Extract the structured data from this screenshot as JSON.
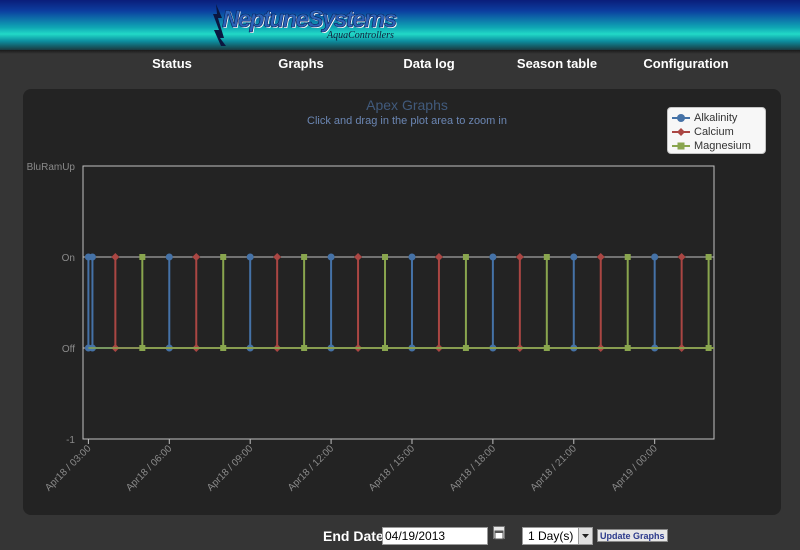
{
  "header": {
    "logo_text": "NeptuneSystems",
    "logo_subtext": "AquaControllers"
  },
  "nav": {
    "items": [
      {
        "label": "Status"
      },
      {
        "label": "Graphs"
      },
      {
        "label": "Data log"
      },
      {
        "label": "Season table"
      },
      {
        "label": "Configuration"
      }
    ]
  },
  "colors": {
    "alkalinity": "#4572a7",
    "calcium": "#aa4643",
    "magnesium": "#89a54e",
    "title": "#415a7c",
    "subtitle": "#6b86b3"
  },
  "chart_data": {
    "type": "line",
    "title": "Apex Graphs",
    "subtitle": "Click and drag in the plot area to zoom in",
    "step": true,
    "x_tick_labels": [
      "Apr18 / 03:00",
      "Apr18 / 06:00",
      "Apr18 / 09:00",
      "Apr18 / 12:00",
      "Apr18 / 15:00",
      "Apr18 / 18:00",
      "Apr18 / 21:00",
      "Apr19 / 00:00"
    ],
    "x_tick_hours": [
      3,
      6,
      9,
      12,
      15,
      18,
      21,
      24
    ],
    "xlim_hours": [
      2.8,
      26.2
    ],
    "y_tick_labels": [
      "BluRamUp",
      "On",
      "Off",
      "-1"
    ],
    "y_tick_values": [
      2,
      1,
      0,
      -1
    ],
    "ylim": [
      -1,
      2
    ],
    "grid": true,
    "legend_position": "top-right",
    "series": [
      {
        "name": "Alkalinity",
        "marker": "circle",
        "x_hours": [
          3.0,
          3.15,
          6.0,
          9.0,
          12.0,
          15.0,
          18.0,
          21.0,
          24.0
        ],
        "y": [
          0,
          1,
          1,
          1,
          1,
          1,
          1,
          1,
          1
        ]
      },
      {
        "name": "Calcium",
        "marker": "diamond",
        "x_hours": [
          4.0,
          7.0,
          10.0,
          13.0,
          16.0,
          19.0,
          22.0,
          25.0
        ],
        "y": [
          1,
          1,
          1,
          1,
          1,
          1,
          1,
          1
        ]
      },
      {
        "name": "Magnesium",
        "marker": "square",
        "x_hours": [
          5.0,
          8.0,
          11.0,
          14.0,
          17.0,
          20.0,
          23.0,
          26.0
        ],
        "y": [
          1,
          1,
          1,
          1,
          1,
          1,
          1,
          1
        ]
      }
    ]
  },
  "controls": {
    "end_date_label": "End Date",
    "end_date_value": "04/19/2013",
    "range_selected": "1 Day(s)",
    "update_label": "Update Graphs"
  }
}
